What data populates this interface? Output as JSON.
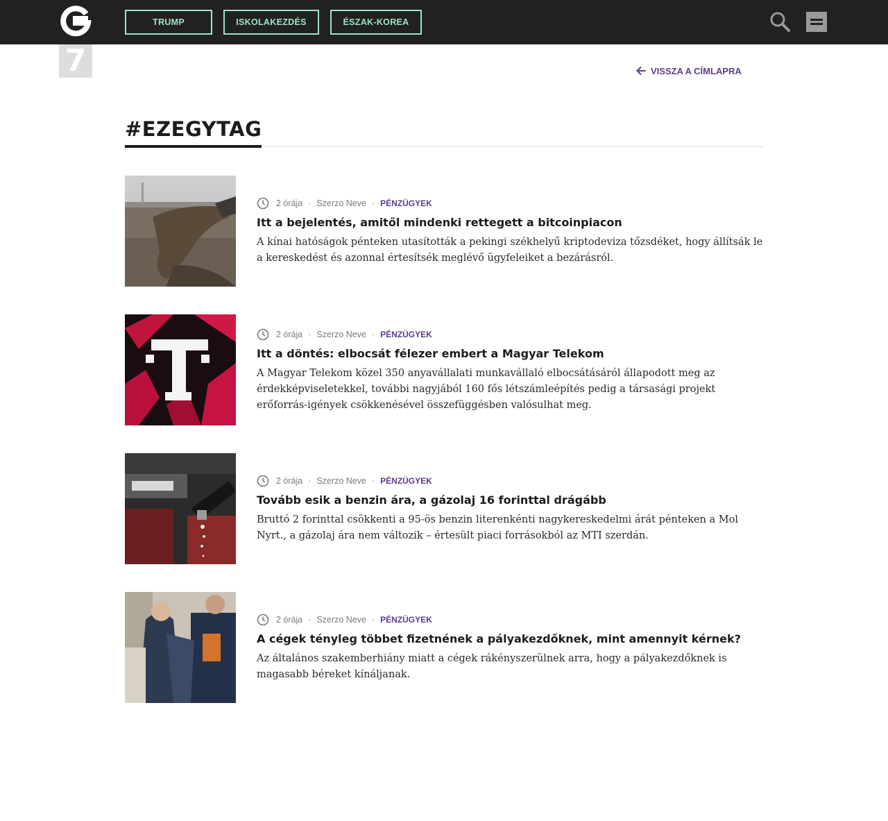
{
  "header": {
    "tags": [
      "TRUMP",
      "ISKOLAKEZDÉS",
      "ÉSZAK-KOREA"
    ],
    "logo_number": "7",
    "logo_letter": "G"
  },
  "back_link": "VISSZA A CÍMLAPRA",
  "tag_title": "#EZEGYTAG",
  "articles": [
    {
      "time": "2 órája",
      "author": "Szerzo Neve",
      "category": "PÉNZÜGYEK",
      "title": "Itt a bejelentés, amitől mindenki rettegett a bitcoinpiacon",
      "lead": "A kínai hatóságok pénteken utasították a pekingi székhelyű kriptodeviza tőzsdéket, hogy állítsák le a kereskedést és azonnal értesítsék meglévő ügyfeleiket a bezárásról."
    },
    {
      "time": "2 órája",
      "author": "Szerzo Neve",
      "category": "PÉNZÜGYEK",
      "title": "Itt a döntés: elbocsát félezer embert a Magyar Telekom",
      "lead": "A Magyar Telekom közel 350 anyavállalati munkavállaló elbocsátásáról állapodott meg az érdekképviseletekkel, további nagyjából 160 fős létszámleépítés pedig a társasági projekt erőforrás-igények csökkenésével összefüggésben valósulhat meg."
    },
    {
      "time": "2 órája",
      "author": "Szerzo Neve",
      "category": "PÉNZÜGYEK",
      "title": "Tovább esik a benzin ára, a gázolaj 16 forinttal drágább",
      "lead": "Bruttó 2 forinttal csökkenti a 95-ös benzin literenkénti nagykereskedelmi árát pénteken a Mol Nyrt., a gázolaj ára nem változik – értesült piaci forrásokból az MTI szerdán."
    },
    {
      "time": "2 órája",
      "author": "Szerzo Neve",
      "category": "PÉNZÜGYEK",
      "title": "A cégek tényleg többet fizetnének a pályakezdőknek, mint amennyit kérnek?",
      "lead": "Az általános szakemberhiány miatt a cégek rákényszerülnek arra, hogy a pályakezdőknek is magasabb béreket kínáljanak."
    }
  ],
  "colors": {
    "topbar": "#212121",
    "tag_button": "#9be6c3",
    "accent": "#5b3c8e",
    "logo_box": "#dddddd"
  },
  "icons": [
    "g-logo-icon",
    "search-icon",
    "hamburger-menu-icon",
    "arrow-left-icon",
    "clock-icon"
  ]
}
